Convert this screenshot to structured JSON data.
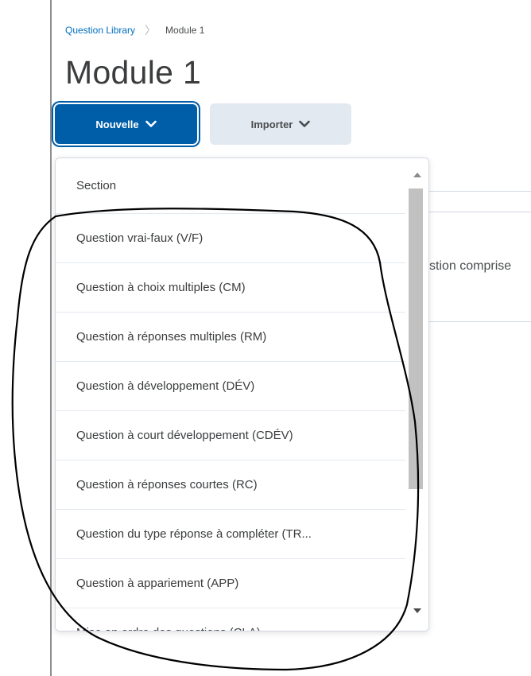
{
  "breadcrumb": {
    "library_label": "Question Library",
    "current_label": "Module 1"
  },
  "page": {
    "title": "Module 1"
  },
  "buttons": {
    "new_label": "Nouvelle",
    "import_label": "Importer"
  },
  "background": {
    "partial_text": "stion comprise"
  },
  "menu": {
    "items": [
      {
        "label": "Section"
      },
      {
        "label": "Question vrai-faux (V/F)"
      },
      {
        "label": "Question à choix multiples (CM)"
      },
      {
        "label": "Question à réponses multiples (RM)"
      },
      {
        "label": "Question à développement (DÉV)"
      },
      {
        "label": "Question à court développement (CDÉV)"
      },
      {
        "label": "Question à réponses courtes (RC)"
      },
      {
        "label": "Question du type réponse à compléter (TR..."
      },
      {
        "label": "Question à appariement (APP)"
      },
      {
        "label": "Mise en ordre des questions (CLA)"
      }
    ]
  },
  "colors": {
    "primary": "#005da8",
    "link": "#006fbf",
    "secondary_button": "#e3e9f1",
    "annotation_stroke": "#000000"
  },
  "icons": {
    "dropdown_chevron": "chevron-down-icon",
    "breadcrumb_separator": "chevron-right-icon"
  }
}
